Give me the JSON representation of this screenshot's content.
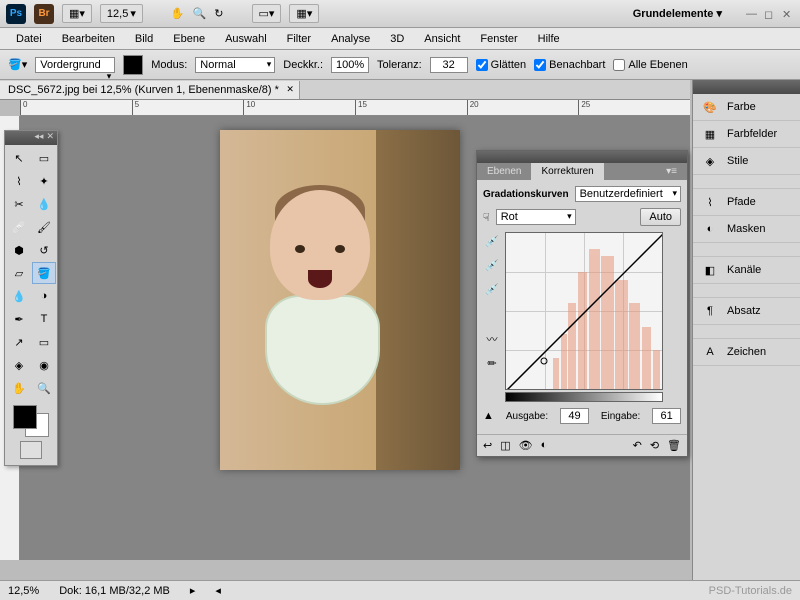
{
  "titlebar": {
    "zoom_options": "12,5",
    "workspace_label": "Grundelemente"
  },
  "menubar": [
    "Datei",
    "Bearbeiten",
    "Bild",
    "Ebene",
    "Auswahl",
    "Filter",
    "Analyse",
    "3D",
    "Ansicht",
    "Fenster",
    "Hilfe"
  ],
  "options": {
    "fill_label": "Vordergrund",
    "mode_label": "Modus:",
    "mode_value": "Normal",
    "opacity_label": "Deckkr.:",
    "opacity_value": "100%",
    "tolerance_label": "Toleranz:",
    "tolerance_value": "32",
    "antialias": "Glätten",
    "contiguous": "Benachbart",
    "all_layers": "Alle Ebenen"
  },
  "document": {
    "tab_title": "DSC_5672.jpg bei 12,5% (Kurven 1, Ebenenmaske/8) *"
  },
  "ruler_marks": [
    "0",
    "5",
    "10",
    "15",
    "20",
    "25"
  ],
  "right_panels": {
    "items": [
      {
        "label": "Farbe",
        "icon": "palette"
      },
      {
        "label": "Farbfelder",
        "icon": "swatches"
      },
      {
        "label": "Stile",
        "icon": "styles"
      },
      {
        "label": "Pfade",
        "icon": "paths"
      },
      {
        "label": "Masken",
        "icon": "masks"
      },
      {
        "label": "Kanäle",
        "icon": "channels"
      },
      {
        "label": "Absatz",
        "icon": "paragraph"
      },
      {
        "label": "Zeichen",
        "icon": "character"
      }
    ]
  },
  "curves": {
    "tabs": [
      "Ebenen",
      "Korrekturen"
    ],
    "title": "Gradationskurven",
    "preset": "Benutzerdefiniert",
    "channel": "Rot",
    "auto_label": "Auto",
    "output_label": "Ausgabe:",
    "output_value": "49",
    "input_label": "Eingabe:",
    "input_value": "61"
  },
  "statusbar": {
    "zoom": "12,5%",
    "docsize": "Dok: 16,1 MB/32,2 MB"
  },
  "watermark": "PSD-Tutorials.de"
}
